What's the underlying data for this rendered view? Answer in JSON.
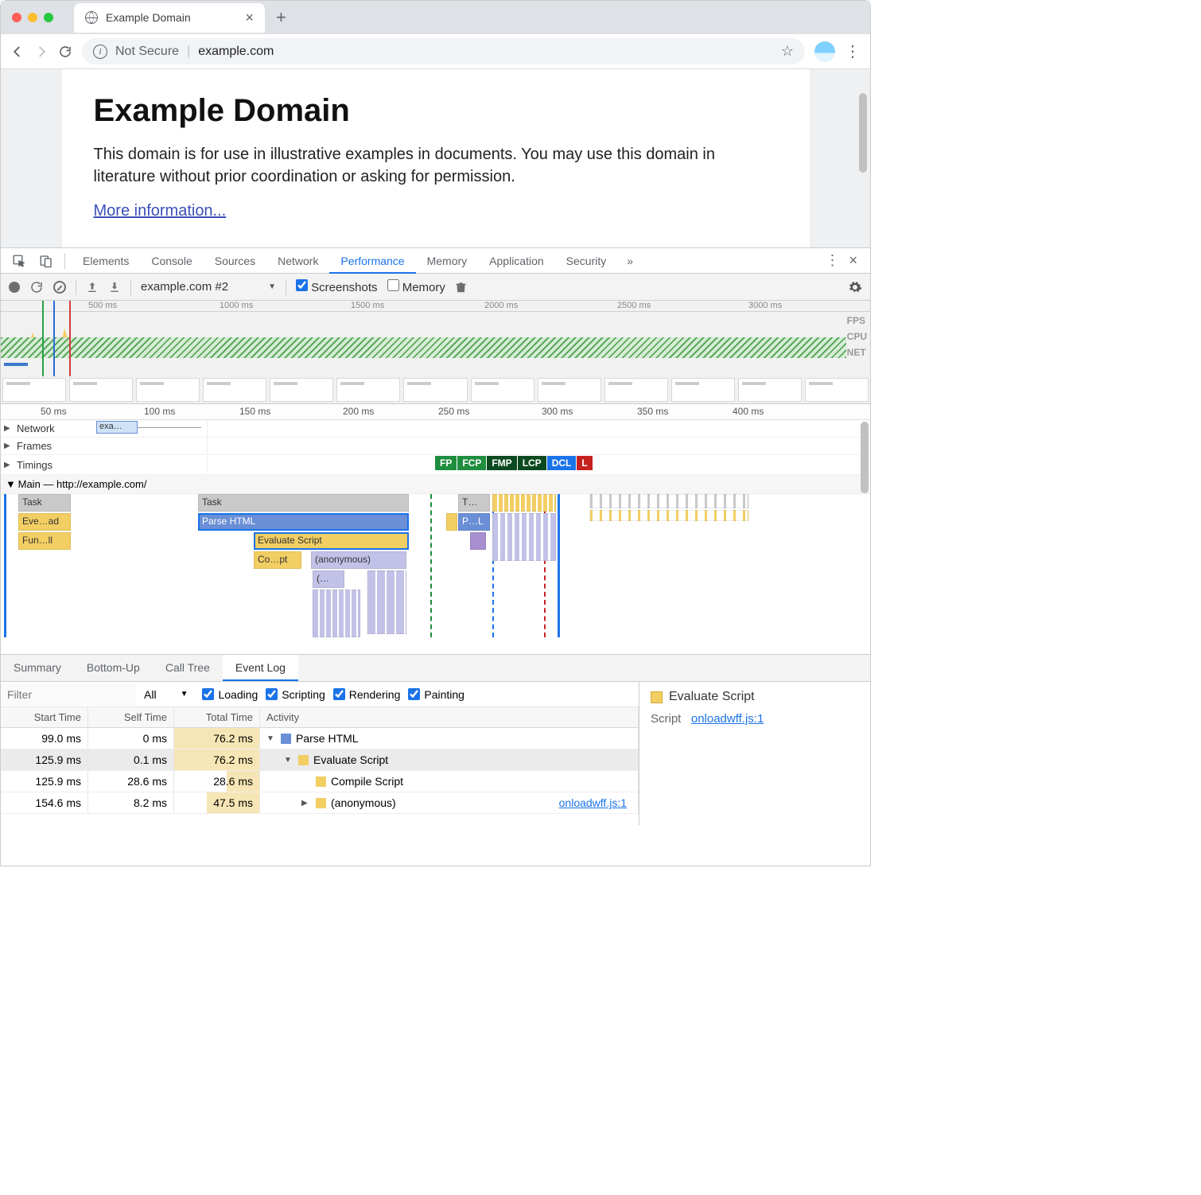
{
  "browser": {
    "tab_title": "Example Domain",
    "not_secure": "Not Secure",
    "url": "example.com"
  },
  "page": {
    "heading": "Example Domain",
    "paragraph": "This domain is for use in illustrative examples in documents. You may use this domain in literature without prior coordination or asking for permission.",
    "link": "More information..."
  },
  "devtools_tabs": [
    "Elements",
    "Console",
    "Sources",
    "Network",
    "Performance",
    "Memory",
    "Application",
    "Security"
  ],
  "devtools_active": "Performance",
  "perf_toolbar": {
    "recording": "example.com #2",
    "screenshots": "Screenshots",
    "memory": "Memory"
  },
  "overview_ticks": [
    "500 ms",
    "1000 ms",
    "1500 ms",
    "2000 ms",
    "2500 ms",
    "3000 ms"
  ],
  "overview_labels": [
    "FPS",
    "CPU",
    "NET"
  ],
  "flame_ticks": [
    "50 ms",
    "100 ms",
    "150 ms",
    "200 ms",
    "250 ms",
    "300 ms",
    "350 ms",
    "400 ms"
  ],
  "flame_rows": {
    "network": "Network",
    "network_item": "exa…",
    "frames": "Frames",
    "timings": "Timings",
    "main": "Main — http://example.com/"
  },
  "timing_badges": [
    "FP",
    "FCP",
    "FMP",
    "LCP",
    "DCL",
    "L"
  ],
  "flame_blocks": {
    "task1": "Task",
    "eve": "Eve…ad",
    "fun": "Fun…ll",
    "task2": "Task",
    "parse": "Parse HTML",
    "eval": "Evaluate Script",
    "copt": "Co…pt",
    "anon": "(anonymous)",
    "paren": "(…",
    "task3": "T…",
    "pl": "P…L"
  },
  "bottom_tabs": [
    "Summary",
    "Bottom-Up",
    "Call Tree",
    "Event Log"
  ],
  "bottom_active": "Event Log",
  "filter_placeholder": "Filter",
  "filter_all": "All",
  "filter_cats": [
    "Loading",
    "Scripting",
    "Rendering",
    "Painting"
  ],
  "ev_cols": [
    "Start Time",
    "Self Time",
    "Total Time",
    "Activity"
  ],
  "ev_rows": [
    {
      "st": "99.0 ms",
      "self": "0 ms",
      "tot": "76.2 ms",
      "indent": 0,
      "tri": "down",
      "sw": "sw-blue",
      "act": "Parse HTML",
      "link": ""
    },
    {
      "st": "125.9 ms",
      "self": "0.1 ms",
      "tot": "76.2 ms",
      "indent": 1,
      "tri": "down",
      "sw": "sw-yel",
      "act": "Evaluate Script",
      "link": "",
      "sel": true
    },
    {
      "st": "125.9 ms",
      "self": "28.6 ms",
      "tot": "28.6 ms",
      "indent": 2,
      "tri": "",
      "sw": "sw-yel",
      "act": "Compile Script",
      "link": ""
    },
    {
      "st": "154.6 ms",
      "self": "8.2 ms",
      "tot": "47.5 ms",
      "indent": 2,
      "tri": "right",
      "sw": "sw-yel",
      "act": "(anonymous)",
      "link": "onloadwff.js:1"
    }
  ],
  "detail": {
    "title": "Evaluate Script",
    "label": "Script",
    "link": "onloadwff.js:1"
  }
}
